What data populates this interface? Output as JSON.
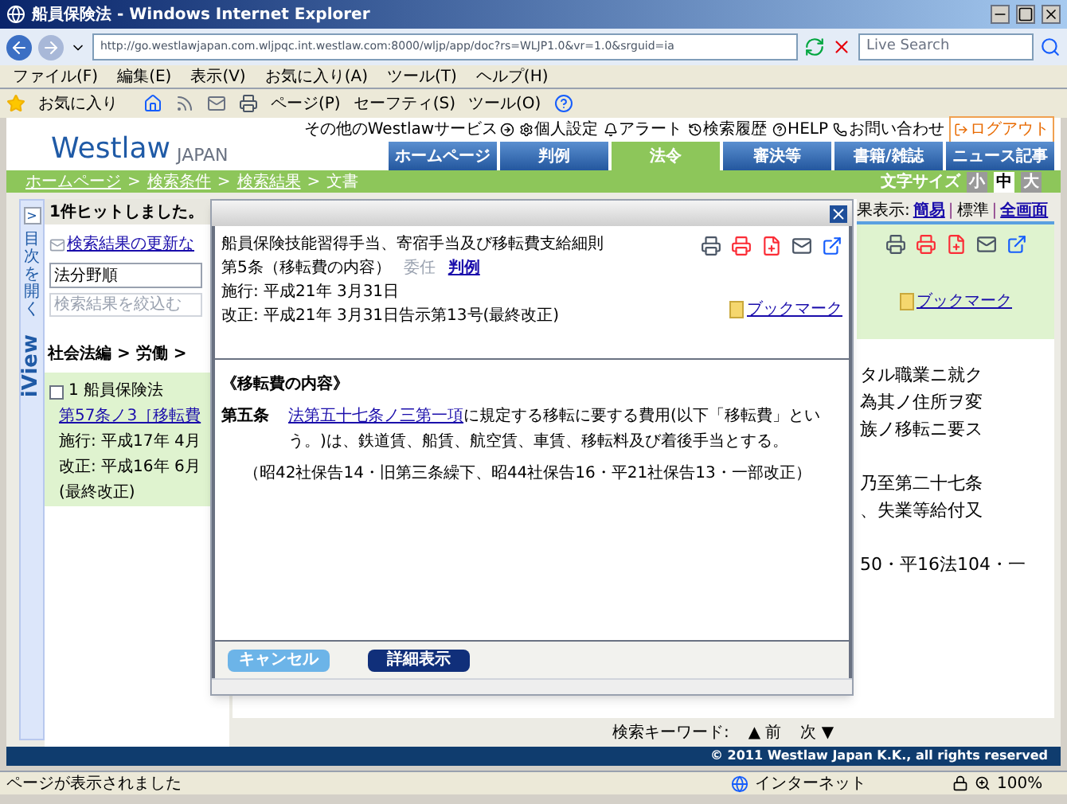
{
  "window": {
    "title": "船員保険法 - Windows Internet Explorer"
  },
  "address_bar": {
    "url": "http://go.westlawjapan.com.wljpqc.int.westlaw.com:8000/wljp/app/doc?rs=WLJP1.0&vr=1.0&srguid=ia",
    "search_placeholder": "Live Search"
  },
  "menu_bar": [
    "ファイル(F)",
    "編集(E)",
    "表示(V)",
    "お気に入り(A)",
    "ツール(T)",
    "ヘルプ(H)"
  ],
  "favorites_bar": {
    "favorites": "お気に入り",
    "menus": [
      "ページ(P)",
      "セーフティ(S)",
      "ツール(O)"
    ]
  },
  "header": {
    "logo": "Westlaw",
    "logo_sub": "JAPAN",
    "top_links": [
      {
        "label": "その他のWestlawサービス",
        "kind": "services"
      },
      {
        "label": "個人設定",
        "kind": "settings"
      },
      {
        "label": "アラート",
        "kind": "alert"
      },
      {
        "label": "検索履歴",
        "kind": "history"
      },
      {
        "label": "HELP",
        "kind": "help"
      },
      {
        "label": "お問い合わせ",
        "kind": "contact"
      },
      {
        "label": "ログアウト",
        "kind": "logout"
      }
    ],
    "tabs": [
      {
        "label": "ホームページ",
        "selected": false
      },
      {
        "label": "判例",
        "selected": false
      },
      {
        "label": "法令",
        "selected": true
      },
      {
        "label": "審決等",
        "selected": false
      },
      {
        "label": "書籍/雑誌",
        "selected": false
      },
      {
        "label": "ニュース記事",
        "selected": false
      }
    ]
  },
  "breadcrumb": {
    "items": [
      "ホームページ",
      "検索条件",
      "検索結果",
      "文書"
    ],
    "separator": ">"
  },
  "font_size": {
    "label": "文字サイズ",
    "options": [
      {
        "label": "小",
        "selected": false
      },
      {
        "label": "中",
        "selected": true
      },
      {
        "label": "大",
        "selected": false
      }
    ]
  },
  "view_strip": {
    "toggle": ">",
    "open_toc": "目次を開く",
    "label": "iView"
  },
  "left_panel": {
    "hit_count": "1件ヒットしました。",
    "update_link": "検索結果の更新な",
    "sort_select": "法分野順",
    "filter_placeholder": "検索結果を絞込む",
    "category_path": "社会法編 > 労働 >",
    "results": [
      {
        "checked": false,
        "number": "1",
        "title": "船員保険法",
        "link": "第57条ノ3［移転費",
        "lines": [
          "施行: 平成17年 4月",
          "改正: 平成16年 6月",
          "(最終改正)"
        ]
      }
    ]
  },
  "modal": {
    "title": "船員保険技能習得手当、寄宿手当及び移転費支給細則",
    "article_heading": "第5条（移転費の内容）",
    "links": [
      {
        "label": "委任",
        "disabled": true
      },
      {
        "label": "判例",
        "disabled": false
      }
    ],
    "enforced": "施行: 平成21年 3月31日",
    "amended": "改正: 平成21年 3月31日告示第13号(最終改正)",
    "bookmark": "ブックマーク",
    "section_heading": "《移転費の内容》",
    "article_number": "第五条",
    "article_link": "法第五十七条ノ三第一項",
    "article_text": "に規定する移転に要する費用(以下「移転費」という。)は、鉄道賃、船賃、航空賃、車賃、移転料及び着後手当とする。",
    "history": "（昭42社保告14・旧第三条繰下、昭44社保告16・平21社保告13・一部改正）",
    "buttons": [
      {
        "label": "キャンセル",
        "kind": "secondary"
      },
      {
        "label": "詳細表示",
        "kind": "primary"
      }
    ]
  },
  "document": {
    "result_view": {
      "label": "果表示:",
      "separator": "|",
      "options": [
        {
          "label": "簡易",
          "selected": false
        },
        {
          "label": "標準",
          "selected": true
        },
        {
          "label": "全画面",
          "selected": false
        }
      ]
    },
    "bookmark": "ブックマーク",
    "text_paragraphs": [
      [
        "タル職業ニ就ク",
        "為其ノ住所ヲ変",
        "族ノ移転ニ要ス"
      ],
      [
        "乃至第二十七条",
        "、失業等給付又"
      ],
      [
        "50・平16法104・一"
      ]
    ],
    "keyword_nav": {
      "label": "検索キーワード:",
      "prev": "▲ 前",
      "next": "次 ▼"
    }
  },
  "footer": "© 2011 Westlaw Japan K.K., all rights reserved",
  "status_bar": {
    "message": "ページが表示されました",
    "zone": "インターネット",
    "zoom": "100%"
  }
}
